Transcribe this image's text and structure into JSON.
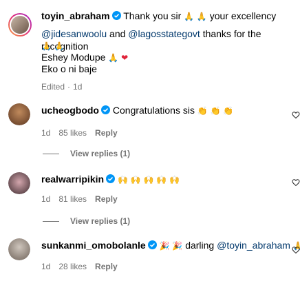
{
  "caption": {
    "username": "toyin_abraham",
    "line1_text": "Thank you sir",
    "line1_emoji": "🙏 🙏",
    "line1_tail": "your excellency",
    "mention1": "@jidesanwoolu",
    "and_text": "and",
    "mention2": "@lagosstategovt",
    "line2_tail": "thanks for the recognition",
    "line3_emoji": "🙏 🙏",
    "line4_text": "Eshey Modupe",
    "line4_emoji_pray": "🙏",
    "line4_emoji_heart": "❤",
    "line5_text": "Eko o ni baje",
    "edited": "Edited",
    "time": "1d"
  },
  "comments": [
    {
      "username": "ucheogbodo",
      "text": "Congratulations sis",
      "emoji": "👏 👏 👏",
      "time": "1d",
      "likes": "85 likes",
      "reply": "Reply",
      "view_replies": "View replies (1)",
      "avatar_color": "#8a5a3c"
    },
    {
      "username": "realwarripikin",
      "text": "",
      "emoji": "🙌 🙌 🙌 🙌 🙌",
      "time": "1d",
      "likes": "81 likes",
      "reply": "Reply",
      "view_replies": "View replies (1)",
      "avatar_color": "#5a3e44"
    },
    {
      "username": "sunkanmi_omobolanle",
      "text_prefix_emoji": "🎉 🎉",
      "text": "darling",
      "mention": "@toyin_abraham",
      "tail_emoji": "🙏",
      "time": "1d",
      "likes": "28 likes",
      "reply": "Reply",
      "avatar_color": "#9a8f86"
    }
  ],
  "colors": {
    "verified": "#0095f6",
    "mention": "#00376b",
    "meta": "#737373"
  }
}
